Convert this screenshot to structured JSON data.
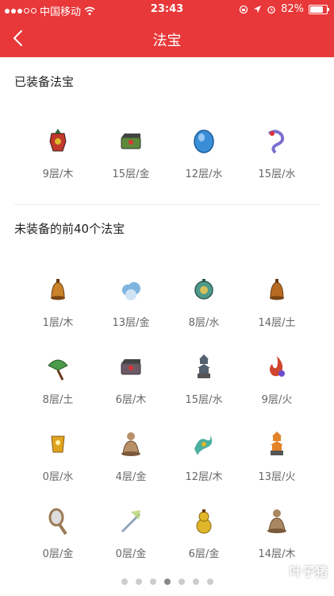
{
  "status": {
    "carrier": "中国移动",
    "time": "23:43",
    "battery": "82%",
    "battery_level": 0.82
  },
  "nav": {
    "title": "法宝"
  },
  "equipped": {
    "title": "已装备法宝",
    "items": [
      {
        "label": "9层/木",
        "icon": "armor-treasure-icon",
        "color": "#c0392b"
      },
      {
        "label": "15层/金",
        "icon": "chest-treasure-icon",
        "color": "#5d8a3a"
      },
      {
        "label": "12层/水",
        "icon": "gem-treasure-icon",
        "color": "#3a8ed8"
      },
      {
        "label": "15层/水",
        "icon": "ribbon-treasure-icon",
        "color": "#7b6fd0"
      }
    ]
  },
  "unequipped": {
    "title": "未装备的前40个法宝",
    "items": [
      {
        "label": "1层/木",
        "icon": "bell-treasure-icon",
        "color": "#c9822a"
      },
      {
        "label": "13层/金",
        "icon": "cloud-treasure-icon",
        "color": "#7fb4e0"
      },
      {
        "label": "8层/水",
        "icon": "lamp-treasure-icon",
        "color": "#4f9a8a"
      },
      {
        "label": "14层/土",
        "icon": "bell-treasure-icon",
        "color": "#b76b22"
      },
      {
        "label": "8层/土",
        "icon": "fan-treasure-icon",
        "color": "#4a9a4a"
      },
      {
        "label": "6层/木",
        "icon": "box-treasure-icon",
        "color": "#6b5a66"
      },
      {
        "label": "15层/水",
        "icon": "pagoda-treasure-icon",
        "color": "#556070"
      },
      {
        "label": "9层/火",
        "icon": "flame-treasure-icon",
        "color": "#d0452f"
      },
      {
        "label": "0层/水",
        "icon": "talisman-treasure-icon",
        "color": "#e0a41e"
      },
      {
        "label": "4层/金",
        "icon": "buddha-treasure-icon",
        "color": "#b89068"
      },
      {
        "label": "12层/木",
        "icon": "dragon-treasure-icon",
        "color": "#4ab0a0"
      },
      {
        "label": "13层/火",
        "icon": "tower-treasure-icon",
        "color": "#e2832a"
      },
      {
        "label": "0层/金",
        "icon": "mirror-treasure-icon",
        "color": "#9a7a55"
      },
      {
        "label": "0层/金",
        "icon": "sword-treasure-icon",
        "color": "#8ea3b8"
      },
      {
        "label": "6层/金",
        "icon": "gourd-treasure-icon",
        "color": "#e0b62b"
      },
      {
        "label": "14层/木",
        "icon": "buddha-treasure-icon",
        "color": "#a98762"
      }
    ]
  },
  "pager": {
    "count": 7,
    "active_index": 3
  },
  "watermark": "叶子猪"
}
